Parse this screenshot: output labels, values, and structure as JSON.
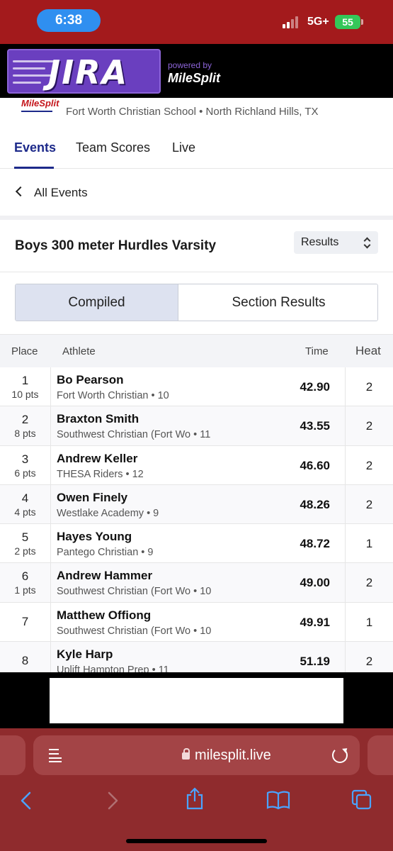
{
  "status_bar": {
    "time": "6:38",
    "network": "5G+",
    "battery": "55"
  },
  "banner": {
    "logo_text": "JIRA",
    "powered_by": "powered by",
    "brand": "MileSplit"
  },
  "meet": {
    "logo_text": "MileSplit",
    "location": "Fort Worth Christian School • North Richland Hills, TX"
  },
  "tabs": [
    {
      "label": "Events",
      "active": true
    },
    {
      "label": "Team Scores",
      "active": false
    },
    {
      "label": "Live",
      "active": false
    }
  ],
  "back_link": "All Events",
  "event": {
    "title": "Boys 300 meter Hurdles Varsity",
    "view_select": "Results"
  },
  "segment": {
    "compiled": "Compiled",
    "section_results": "Section Results"
  },
  "table": {
    "headers": {
      "place": "Place",
      "athlete": "Athlete",
      "time": "Time",
      "heat": "Heat"
    },
    "rows": [
      {
        "place": "1",
        "pts": "10 pts",
        "name": "Bo Pearson",
        "team": "Fort Worth Christian • 10",
        "time": "42.90",
        "heat": "2"
      },
      {
        "place": "2",
        "pts": "8 pts",
        "name": "Braxton Smith",
        "team": "Southwest Christian (Fort Wo • 11",
        "time": "43.55",
        "heat": "2"
      },
      {
        "place": "3",
        "pts": "6 pts",
        "name": "Andrew Keller",
        "team": "THESA Riders • 12",
        "time": "46.60",
        "heat": "2"
      },
      {
        "place": "4",
        "pts": "4 pts",
        "name": "Owen Finely",
        "team": "Westlake Academy • 9",
        "time": "48.26",
        "heat": "2"
      },
      {
        "place": "5",
        "pts": "2 pts",
        "name": "Hayes Young",
        "team": "Pantego Christian • 9",
        "time": "48.72",
        "heat": "1"
      },
      {
        "place": "6",
        "pts": "1 pts",
        "name": "Andrew Hammer",
        "team": "Southwest Christian (Fort Wo • 10",
        "time": "49.00",
        "heat": "2"
      },
      {
        "place": "7",
        "pts": "",
        "name": "Matthew Offiong",
        "team": "Southwest Christian (Fort Wo • 10",
        "time": "49.91",
        "heat": "1"
      },
      {
        "place": "8",
        "pts": "",
        "name": "Kyle Harp",
        "team": "Uplift Hampton Prep • 11",
        "time": "51.19",
        "heat": "2"
      }
    ]
  },
  "browser": {
    "url": "milesplit.live"
  },
  "colors": {
    "status_bar": "#a31a1c",
    "brand_blue": "#1d2a8a",
    "logo_purple": "#6a3fbf",
    "browser_bar": "#8f2b2d",
    "battery_green": "#34c759"
  }
}
